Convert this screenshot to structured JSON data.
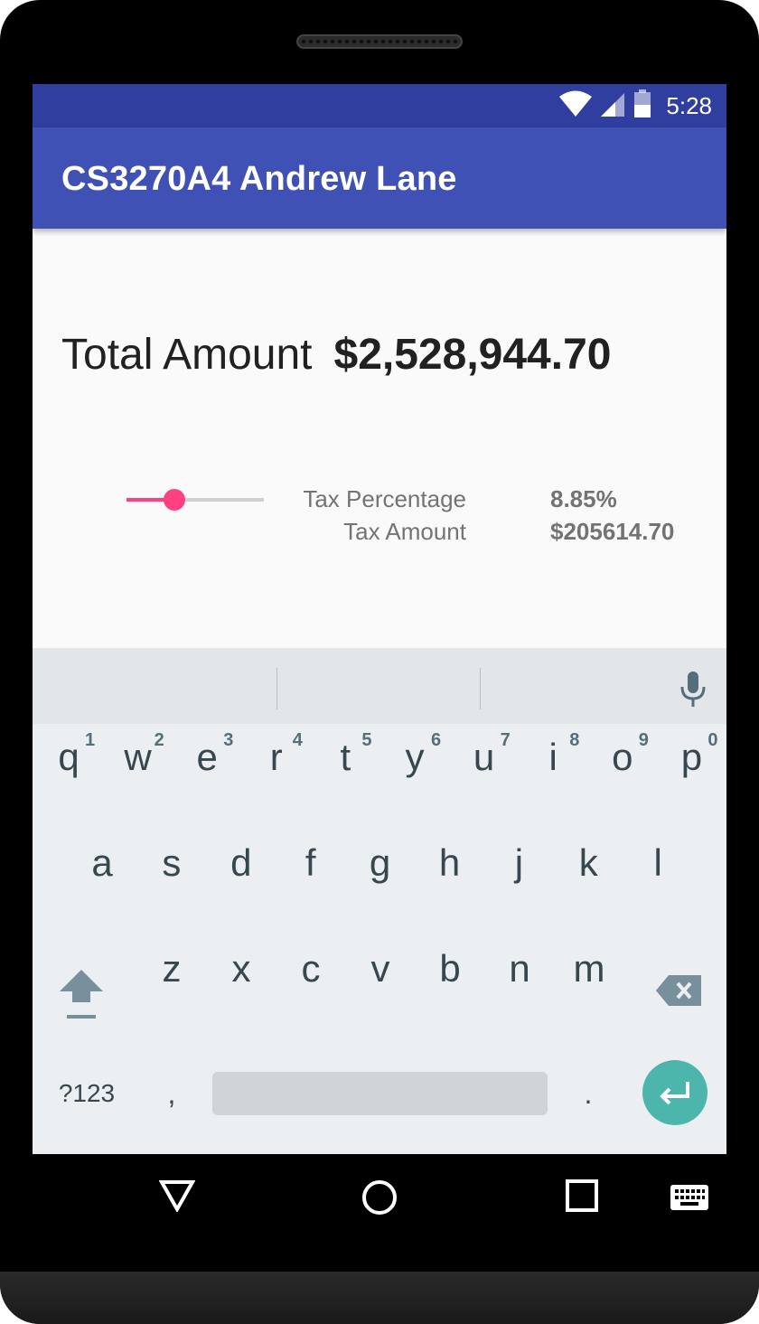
{
  "status_bar": {
    "time": "5:28",
    "icons": [
      "wifi-icon",
      "signal-icon",
      "battery-icon"
    ]
  },
  "app_bar": {
    "title": "CS3270A4 Andrew Lane"
  },
  "main": {
    "total_label": "Total Amount",
    "total_value": "$2,528,944.70",
    "tax_percentage_label": "Tax Percentage",
    "tax_percentage_value": "8.85%",
    "tax_amount_label": "Tax Amount",
    "tax_amount_value": "$205614.70",
    "slider_fraction": 0.35
  },
  "keyboard": {
    "row1": [
      "q",
      "w",
      "e",
      "r",
      "t",
      "y",
      "u",
      "i",
      "o",
      "p"
    ],
    "row1_hints": [
      "1",
      "2",
      "3",
      "4",
      "5",
      "6",
      "7",
      "8",
      "9",
      "0"
    ],
    "row2": [
      "a",
      "s",
      "d",
      "f",
      "g",
      "h",
      "j",
      "k",
      "l"
    ],
    "row3": [
      "z",
      "x",
      "c",
      "v",
      "b",
      "n",
      "m"
    ],
    "symbols_label": "?123",
    "comma": ",",
    "period": "."
  },
  "colors": {
    "status_bar": "#303f9f",
    "app_bar": "#3f51b5",
    "accent": "#ff4081",
    "enter_key": "#4db6ac"
  }
}
